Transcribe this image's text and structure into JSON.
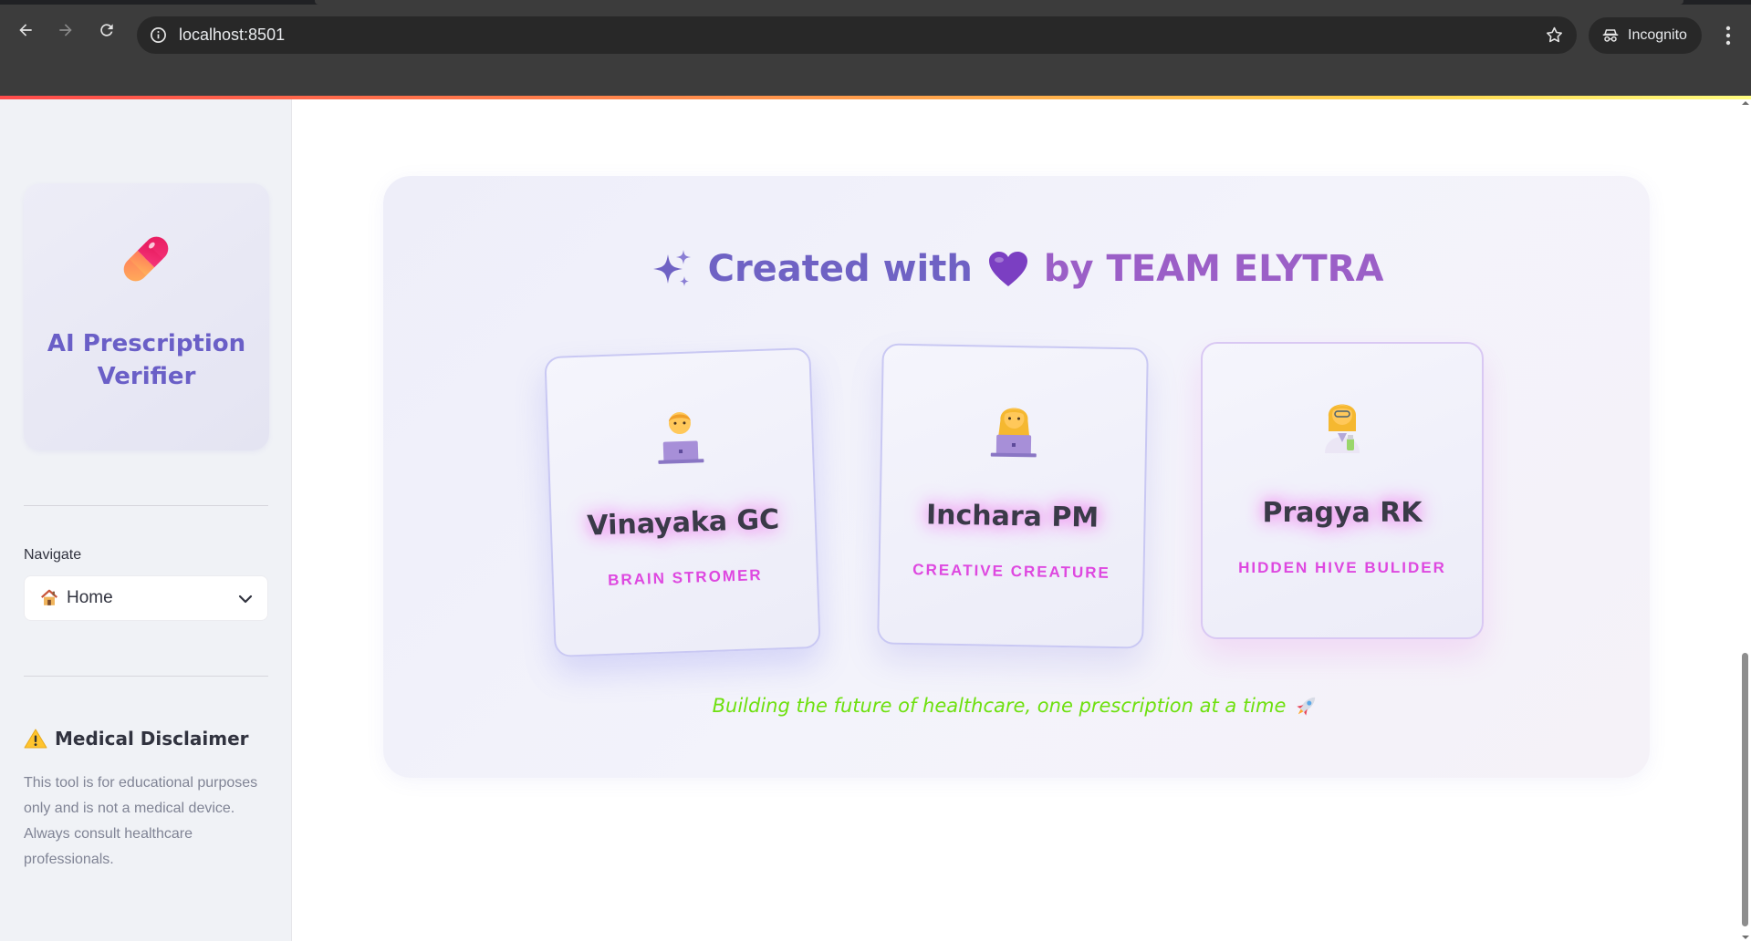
{
  "browser": {
    "url": "localhost:8501",
    "incognito_label": "Incognito"
  },
  "sidebar": {
    "brand": {
      "icon": "pill-icon",
      "title": "AI Prescription Verifier"
    },
    "navigate": {
      "label": "Navigate",
      "selected_icon": "house-icon",
      "selected": "Home"
    },
    "disclaimer": {
      "icon": "warning-icon",
      "title": "Medical Disclaimer",
      "body": "This tool is for educational purposes only and is not a medical device. Always consult healthcare professionals."
    }
  },
  "team": {
    "heading_prefix": "Created with",
    "heading_suffix": "by TEAM ELYTRA",
    "members": [
      {
        "name": "Vinayaka GC",
        "role": "BRAIN STROMER",
        "avatar": "technologist-icon"
      },
      {
        "name": "Inchara PM",
        "role": "CREATIVE CREATURE",
        "avatar": "woman-technologist-icon"
      },
      {
        "name": "Pragya RK",
        "role": "HIDDEN HIVE BULIDER",
        "avatar": "woman-scientist-icon"
      }
    ],
    "tagline": "Building the future of healthcare, one prescription at a time"
  },
  "colors": {
    "accent": "#6f62c4",
    "role": "#de48e0",
    "tagline": "#6ee00f",
    "sidebar_bg": "#f0f2f6"
  }
}
